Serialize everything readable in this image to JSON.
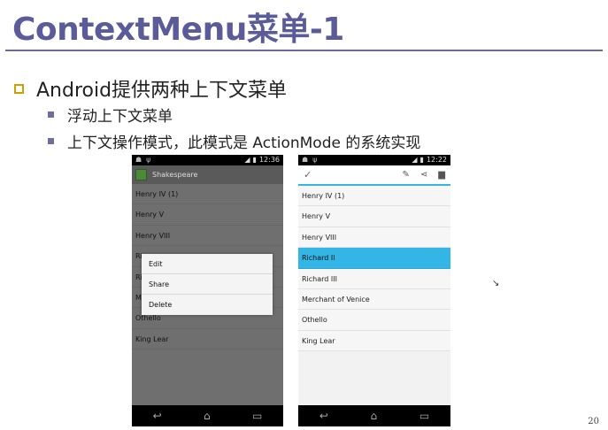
{
  "slide": {
    "title": "ContextMenu菜单-1",
    "bullet": "Android提供两种上下文菜单",
    "sub_bullets": [
      "浮动上下文菜单",
      "上下文操作模式，此模式是 ActionMode 的系统实现"
    ],
    "page_number": "20"
  },
  "phone1": {
    "status_time": "12:36",
    "app_title": "Shakespeare",
    "items": [
      "Henry IV (1)",
      "Henry V",
      "Henry VIII",
      "Ri",
      "Ri",
      "M",
      "Othello",
      "King Lear"
    ],
    "context_menu": [
      "Edit",
      "Share",
      "Delete"
    ]
  },
  "phone2": {
    "status_time": "12:22",
    "action_icons": [
      "check-icon",
      "pencil-icon",
      "share-icon",
      "trash-icon"
    ],
    "items": [
      "Henry IV (1)",
      "Henry V",
      "Henry VIII",
      "Richard II",
      "Richard III",
      "Merchant of Venice",
      "Othello",
      "King Lear"
    ],
    "selected_index": 3
  },
  "colors": {
    "title": "#5b5b99",
    "accent_blue": "#33b5e5",
    "bullet_box": "#c9a200"
  }
}
